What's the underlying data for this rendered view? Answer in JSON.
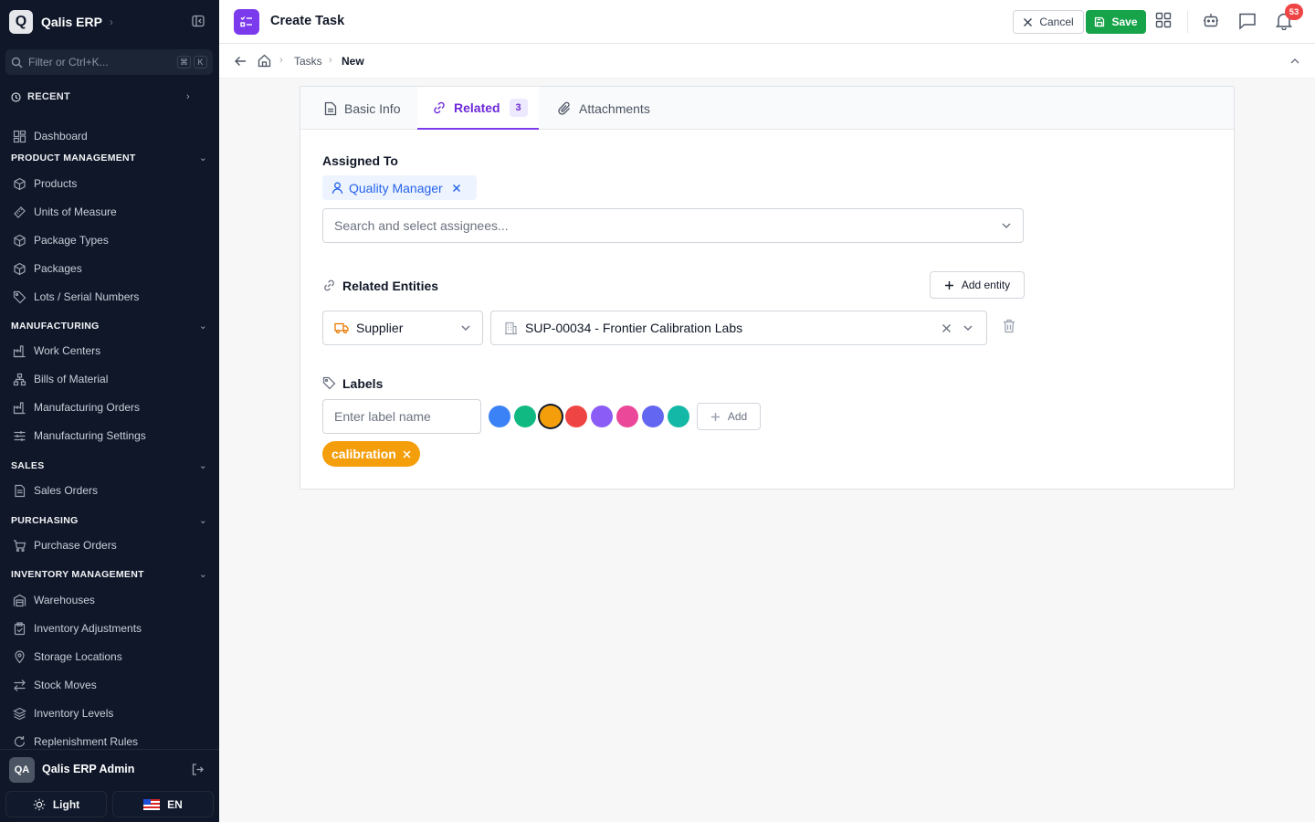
{
  "app": {
    "logo_letter": "Q",
    "name": "Qalis ERP"
  },
  "sidebar": {
    "filter_placeholder": "Filter or Ctrl+K...",
    "kbd1": "⌘",
    "kbd2": "K",
    "recent_label": "RECENT",
    "dashboard": "Dashboard",
    "sections": [
      {
        "title": "PRODUCT MANAGEMENT",
        "items": [
          "Products",
          "Units of Measure",
          "Package Types",
          "Packages",
          "Lots / Serial Numbers"
        ]
      },
      {
        "title": "MANUFACTURING",
        "items": [
          "Work Centers",
          "Bills of Material",
          "Manufacturing Orders",
          "Manufacturing Settings"
        ]
      },
      {
        "title": "SALES",
        "items": [
          "Sales Orders"
        ]
      },
      {
        "title": "PURCHASING",
        "items": [
          "Purchase Orders"
        ]
      },
      {
        "title": "INVENTORY MANAGEMENT",
        "items": [
          "Warehouses",
          "Inventory Adjustments",
          "Storage Locations",
          "Stock Moves",
          "Inventory Levels",
          "Replenishment Rules"
        ]
      }
    ],
    "user": {
      "initials": "QA",
      "name": "Qalis ERP Admin"
    },
    "theme_label": "Light",
    "language_label": "EN"
  },
  "header": {
    "title": "Create Task",
    "cancel_label": "Cancel",
    "save_label": "Save",
    "notification_count": "53"
  },
  "breadcrumb": {
    "items": [
      "Tasks",
      "New"
    ]
  },
  "tabs": [
    {
      "label": "Basic Info"
    },
    {
      "label": "Related",
      "count": "3"
    },
    {
      "label": "Attachments"
    }
  ],
  "form": {
    "assigned_to_label": "Assigned To",
    "assignee_chip": "Quality Manager",
    "assignee_placeholder": "Search and select assignees...",
    "related_entities_label": "Related Entities",
    "add_entity_label": "Add entity",
    "entity_type": "Supplier",
    "entity_value": "SUP-00034 - Frontier Calibration Labs",
    "labels_label": "Labels",
    "label_placeholder": "Enter label name",
    "add_label": "Add",
    "label_colors": [
      "#3b82f6",
      "#10b981",
      "#f59e0b",
      "#ef4444",
      "#8b5cf6",
      "#ec4899",
      "#6366f1",
      "#14b8a6"
    ],
    "selected_color": "#f59e0b",
    "label_chip": "calibration"
  }
}
